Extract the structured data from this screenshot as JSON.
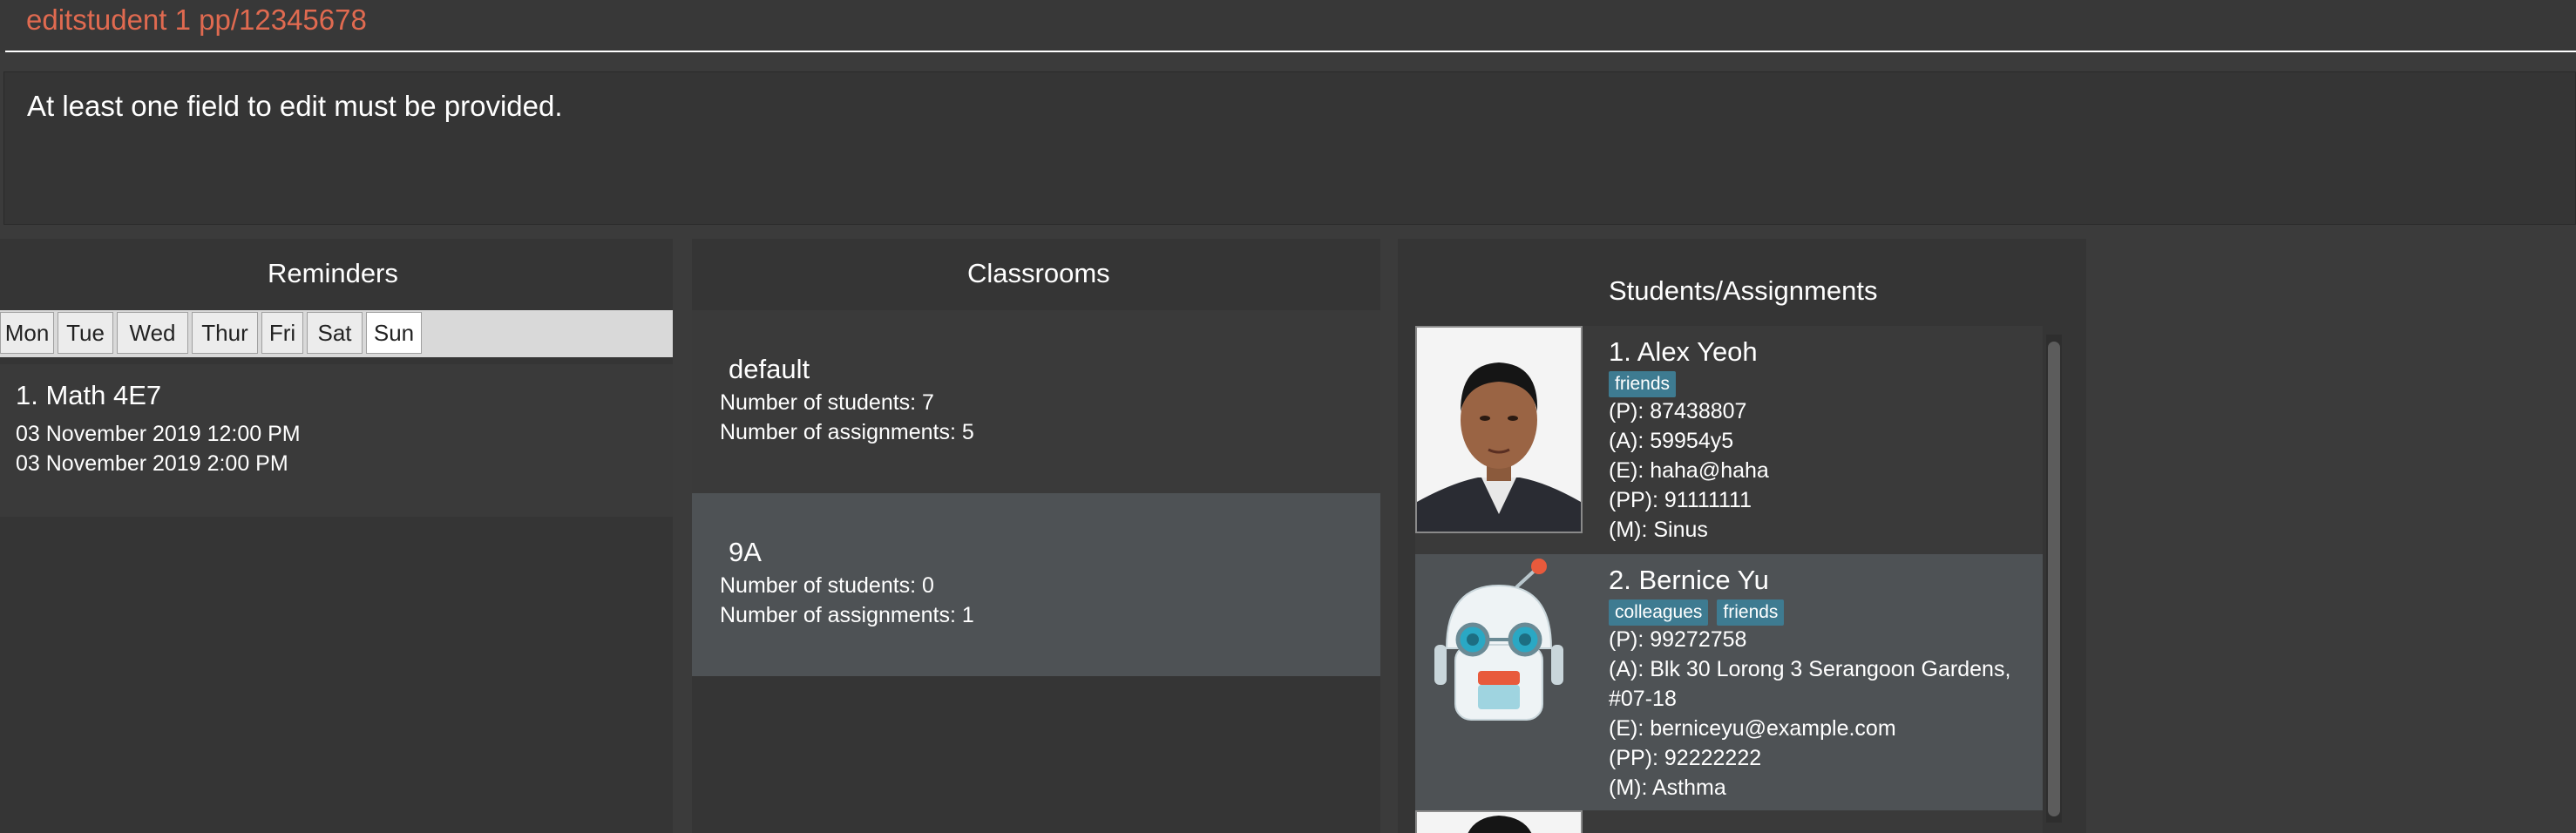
{
  "command": {
    "text": "editstudent 1 pp/12345678"
  },
  "result": {
    "text": "At least one field to edit must be provided."
  },
  "reminders": {
    "title": "Reminders",
    "days": [
      "Mon",
      "Tue",
      "Wed",
      "Thur",
      "Fri",
      "Sat",
      "Sun"
    ],
    "active_day": "Sun",
    "items": [
      {
        "title": "1.  Math 4E7",
        "lines": [
          "03 November 2019 12:00 PM",
          "03 November 2019 2:00 PM"
        ]
      }
    ]
  },
  "classrooms": {
    "title": "Classrooms",
    "items": [
      {
        "name": "default",
        "students": "Number of students: 7",
        "assignments": "Number of assignments: 5"
      },
      {
        "name": "9A",
        "students": "Number of students: 0",
        "assignments": "Number of assignments: 1"
      }
    ]
  },
  "students": {
    "title": "Students/Assignments",
    "items": [
      {
        "name": "1.  Alex Yeoh",
        "tags": [
          "friends"
        ],
        "phone": "(P): 87438807",
        "address": "(A): 59954y5",
        "email": "(E): haha@haha",
        "parent_phone": "(PP): 91111111",
        "medical": "(M): Sinus"
      },
      {
        "name": "2.  Bernice Yu",
        "tags": [
          "colleagues",
          "friends"
        ],
        "phone": "(P): 99272758",
        "address_line1": "(A): Blk 30 Lorong 3 Serangoon Gardens,",
        "address_line2": "#07-18",
        "email": "(E): berniceyu@example.com",
        "parent_phone": "(PP): 92222222",
        "medical": "(M): Asthma"
      }
    ]
  },
  "colors": {
    "command_text": "#e06a50",
    "tag": "#3e7b91",
    "selected_row": "#4e5255"
  }
}
